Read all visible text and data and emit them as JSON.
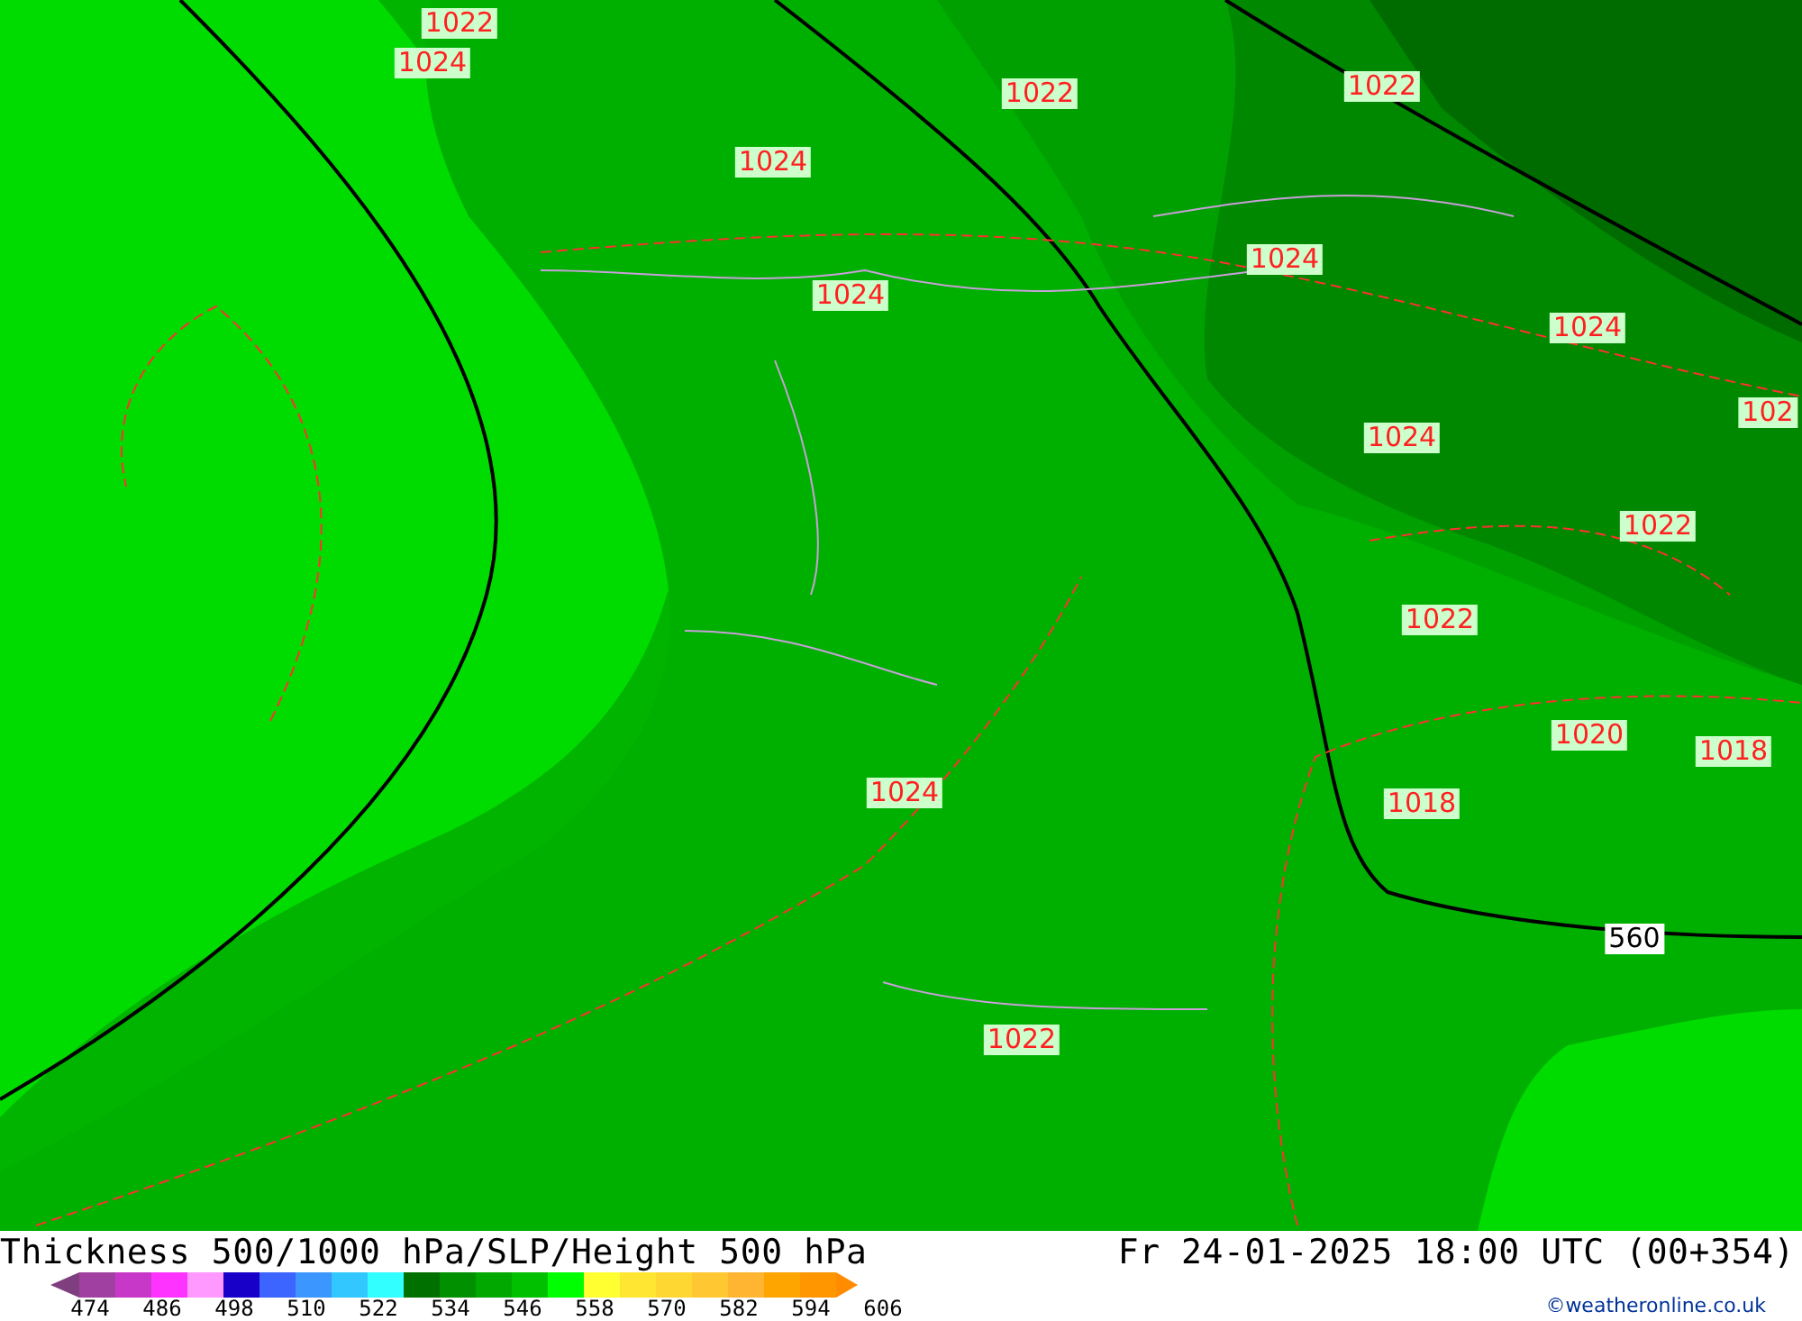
{
  "map": {
    "labels": [
      {
        "text": "1022",
        "kind": "slp"
      },
      {
        "text": "1024",
        "kind": "slp"
      },
      {
        "text": "1022",
        "kind": "slp"
      },
      {
        "text": "1022",
        "kind": "slp"
      },
      {
        "text": "1024",
        "kind": "slp"
      },
      {
        "text": "1024",
        "kind": "slp"
      },
      {
        "text": "1024",
        "kind": "slp"
      },
      {
        "text": "1024",
        "kind": "slp"
      },
      {
        "text": "102",
        "kind": "slp"
      },
      {
        "text": "1024",
        "kind": "slp"
      },
      {
        "text": "1022",
        "kind": "slp"
      },
      {
        "text": "1022",
        "kind": "slp"
      },
      {
        "text": "1020",
        "kind": "slp"
      },
      {
        "text": "1018",
        "kind": "slp"
      },
      {
        "text": "1018",
        "kind": "slp"
      },
      {
        "text": "1024",
        "kind": "slp"
      },
      {
        "text": "560",
        "kind": "height"
      },
      {
        "text": "1022",
        "kind": "slp"
      }
    ]
  },
  "footer": {
    "title": "Thickness 500/1000 hPa/SLP/Height 500 hPa",
    "valid_time": "Fr 24-01-2025 18:00 UTC (00+354)",
    "credit": "©weatheronline.co.uk",
    "legend": {
      "swatches": [
        {
          "color": "#7f3f7f"
        },
        {
          "color": "#a040a0"
        },
        {
          "color": "#c838c8"
        },
        {
          "color": "#ff33ff"
        },
        {
          "color": "#ff99ff"
        },
        {
          "color": "#1800c8"
        },
        {
          "color": "#3c64ff"
        },
        {
          "color": "#3c96ff"
        },
        {
          "color": "#32c8ff"
        },
        {
          "color": "#32ffff"
        },
        {
          "color": "#007000"
        },
        {
          "color": "#009000"
        },
        {
          "color": "#00a800"
        },
        {
          "color": "#00c000"
        },
        {
          "color": "#00ff00"
        },
        {
          "color": "#ffff32"
        },
        {
          "color": "#ffe632"
        },
        {
          "color": "#ffd732"
        },
        {
          "color": "#ffc832"
        },
        {
          "color": "#ffb432"
        },
        {
          "color": "#ffa500"
        },
        {
          "color": "#ff9600"
        },
        {
          "color": "#ff8c00"
        }
      ],
      "labels": [
        "474",
        "486",
        "498",
        "510",
        "522",
        "534",
        "546",
        "558",
        "570",
        "582",
        "594",
        "606"
      ]
    }
  }
}
